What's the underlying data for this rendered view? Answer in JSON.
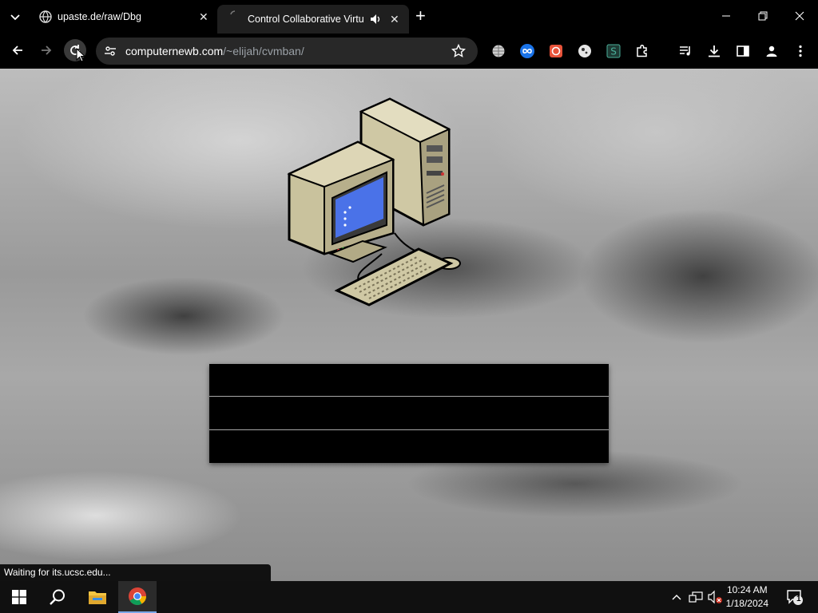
{
  "browser": {
    "tabs": [
      {
        "title": "upaste.de/raw/Dbg",
        "active": false
      },
      {
        "title": "Control Collaborative Virtua",
        "active": true,
        "audio": true
      }
    ],
    "new_tab_label": "+",
    "url_host": "computernewb.com",
    "url_path": "/~elijah/cvmban/",
    "status_text": "Waiting for its.ucsc.edu..."
  },
  "page": {
    "menu_rows": [
      "",
      "",
      ""
    ],
    "hero_image": "retro-computer-icon"
  },
  "extensions": [
    "globe-icon",
    "infinity-icon",
    "record-icon",
    "cookie-icon",
    "s-icon",
    "puzzle-icon"
  ],
  "taskbar": {
    "apps": [
      "windows-start-icon",
      "search-icon",
      "file-explorer-icon",
      "chrome-icon"
    ],
    "time": "10:24 AM",
    "date": "1/18/2024",
    "notification_count": "1"
  },
  "colors": {
    "accent": "#4a72e8",
    "chrome_red": "#db4437",
    "chrome_green": "#0f9d58",
    "chrome_yellow": "#f4b400"
  }
}
